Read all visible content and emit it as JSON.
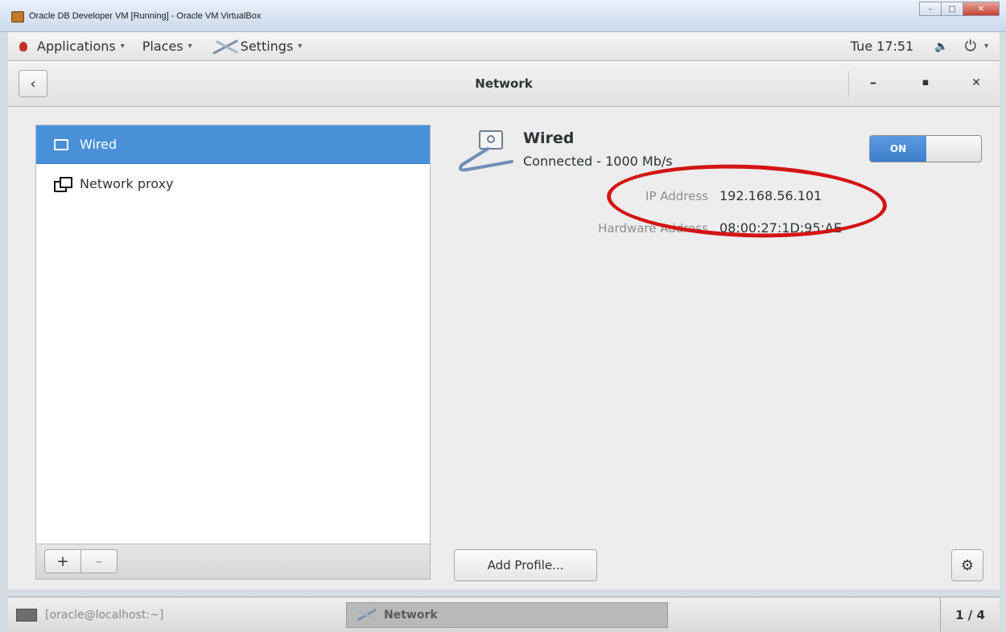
{
  "host_window": {
    "title": "Oracle DB Developer VM [Running] - Oracle VM VirtualBox",
    "controls": [
      "–",
      "□",
      "✕"
    ]
  },
  "topbar": {
    "applications": "Applications",
    "places": "Places",
    "settings": "Settings",
    "clock": "Tue 17:51",
    "volume_icon": "🔈",
    "power_icon": "⏻",
    "arrow": "▾"
  },
  "headerbar": {
    "back": "‹",
    "title": "Network",
    "minimize": "–",
    "maximize": "▪",
    "close": "✕"
  },
  "sidebar": {
    "items": [
      {
        "label": "Wired"
      },
      {
        "label": "Network proxy"
      }
    ],
    "add": "+",
    "remove": "–"
  },
  "detail": {
    "title": "Wired",
    "status": "Connected - 1000 Mb/s",
    "switch_label": "ON",
    "ip_label": "IP Address",
    "ip_value": "192.168.56.101",
    "hw_label": "Hardware Address",
    "hw_value": "08:00:27:1D:95:AE"
  },
  "footer": {
    "add_profile": "Add Profile...",
    "gear": "⚙"
  },
  "taskbar": {
    "terminal": "[oracle@localhost:~]",
    "network": "Network",
    "workspace": "1 / 4"
  },
  "colors": {
    "selection": "#4a90d9",
    "highlight": "#d21414"
  }
}
